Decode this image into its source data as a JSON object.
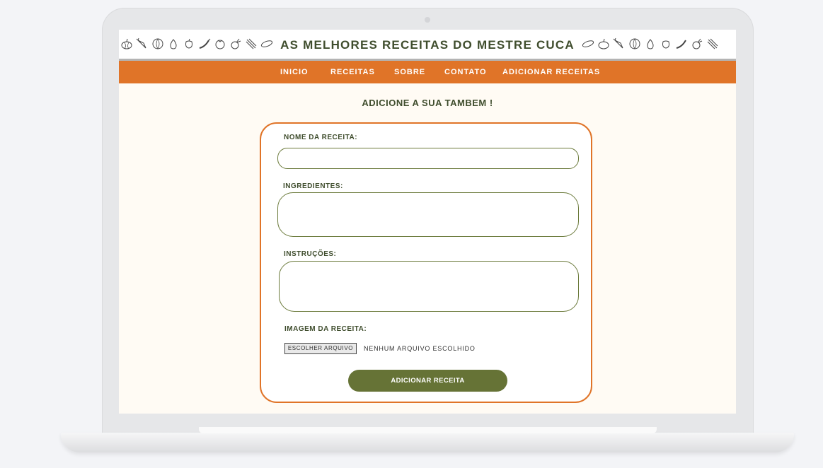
{
  "site": {
    "title": "AS MELHORES RECEITAS DO MESTRE CUCA"
  },
  "nav": {
    "items": [
      "INICIO",
      "RECEITAS",
      "SOBRE",
      "CONTATO",
      "ADICIONAR RECEITAS"
    ]
  },
  "page": {
    "heading": "ADICIONE A SUA TAMBEM !"
  },
  "form": {
    "name_label": "NOME DA RECEITA:",
    "name_value": "",
    "ingredients_label": "INGREDIENTES:",
    "ingredients_value": "",
    "instructions_label": "INSTRUÇÕES:",
    "instructions_value": "",
    "image_label": "IMAGEM DA RECEITA:",
    "file_button_label": "ESCOLHER ARQUIVO",
    "file_status": "NENHUM ARQUIVO ESCOLHIDO",
    "submit_label": "ADICIONAR RECEITA"
  },
  "icons": {
    "header_decoration": "vegetable-doodle-icons"
  },
  "colors": {
    "accent_orange": "#e07428",
    "olive_green": "#667336",
    "text_dark_green": "#3f4d2d",
    "page_background": "#fffbf4"
  }
}
